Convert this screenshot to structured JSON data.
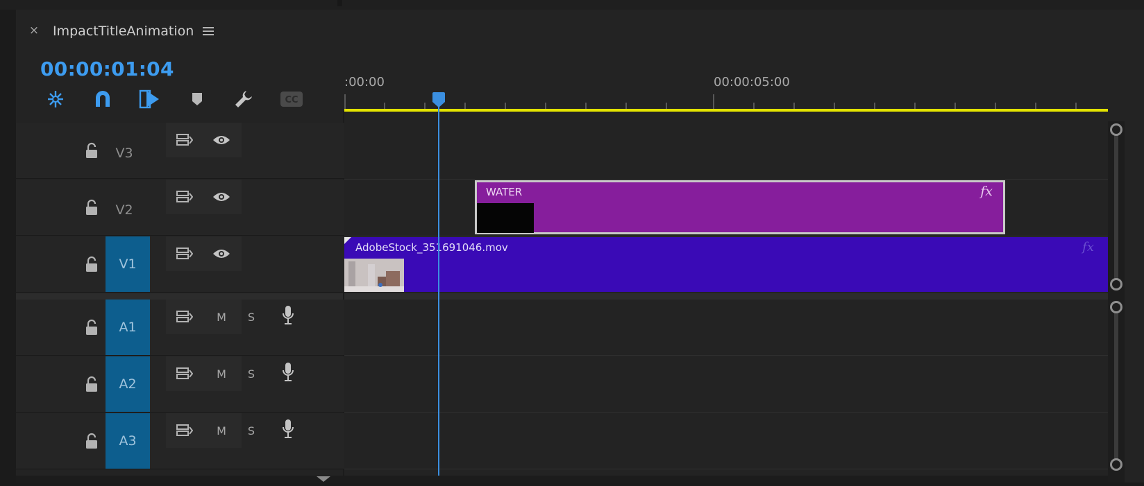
{
  "sequence": {
    "title": "ImpactTitleAnimation",
    "close_label": "×",
    "timecode": "00:00:01:04"
  },
  "toolbar": {
    "icons": [
      "insert-overwrite-icon",
      "snap-magnet-icon",
      "linked-selection-icon",
      "add-marker-icon",
      "wrench-icon",
      "captions-icon"
    ],
    "captions_label": "CC"
  },
  "ruler": {
    "labels": [
      ":00:00",
      "00:00:05:00"
    ],
    "work_area_color": "#e3e300"
  },
  "tracks": {
    "video": [
      {
        "name": "V3",
        "targeted": false
      },
      {
        "name": "V2",
        "targeted": false
      },
      {
        "name": "V1",
        "targeted": true
      }
    ],
    "audio": [
      {
        "name": "A1",
        "targeted": true,
        "mute_label": "M",
        "solo_label": "S"
      },
      {
        "name": "A2",
        "targeted": true,
        "mute_label": "M",
        "solo_label": "S"
      },
      {
        "name": "A3",
        "targeted": true,
        "mute_label": "M",
        "solo_label": "S"
      }
    ]
  },
  "clips": {
    "v2": {
      "name": "WATER",
      "fx_label": "fx",
      "color": "#861e9c"
    },
    "v1": {
      "name": "AdobeStock_351691046.mov",
      "fx_label": "fx",
      "color": "#3a0ab6"
    }
  },
  "colors": {
    "accent": "#3d9cf0",
    "track_target": "#0d5e8e",
    "playhead": "#3b8fe0"
  }
}
